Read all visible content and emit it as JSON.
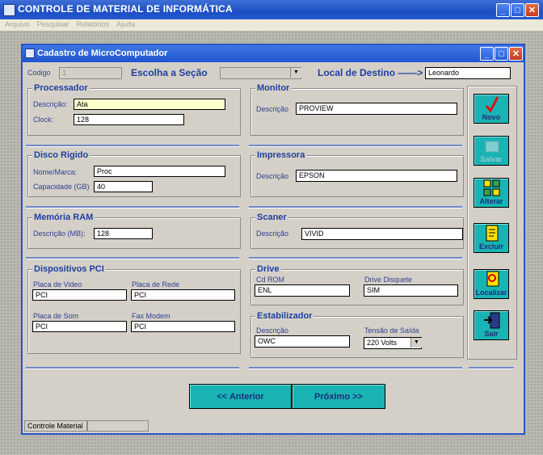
{
  "app": {
    "title": "CONTROLE DE MATERIAL DE INFORMÁTICA"
  },
  "menu": [
    "Arquivo",
    "Pesquisar",
    "Relatórios",
    "Ajuda"
  ],
  "form": {
    "title": "Cadastro de MicroComputador",
    "codigo_label": "Codigo",
    "codigo_value": "1",
    "secao_label": "Escolha a Seção",
    "secao_value": "",
    "destino_label": "Local de Destino ——>",
    "destino_value": "Leonardo"
  },
  "processador": {
    "title": "Processador",
    "desc_label": "Descrição:",
    "desc_value": "Ata",
    "clock_label": "Clock:",
    "clock_value": "128"
  },
  "disco": {
    "title": "Disco Rigido",
    "nome_label": "Nome/Marca:",
    "nome_value": "Proc",
    "cap_label": "Capacidade (GB)",
    "cap_value": "40"
  },
  "memoria": {
    "title": "Memória RAM",
    "desc_label": "Descrição (MB):",
    "desc_value": "128"
  },
  "pci": {
    "title": "Dispositivos PCI",
    "video_label": "Placa de Video",
    "video_value": "PCI",
    "rede_label": "Placa de Rede",
    "rede_value": "PCI",
    "som_label": "Placa de Som",
    "som_value": "PCI",
    "fax_label": "Fax Modem",
    "fax_value": "PCI"
  },
  "monitor": {
    "title": "Monitor",
    "desc_label": "Descrição",
    "desc_value": "PROVIEW"
  },
  "impressora": {
    "title": "Impressora",
    "desc_label": "Descrição",
    "desc_value": "EPSON"
  },
  "scaner": {
    "title": "Scaner",
    "desc_label": "Descrição",
    "desc_value": "VIVID"
  },
  "drive": {
    "title": "Drive",
    "cd_label": "Cd ROM",
    "cd_value": "ENL",
    "disq_label": "Drive Disquete",
    "disq_value": "SIM"
  },
  "estab": {
    "title": "Estabilizador",
    "desc_label": "Descrição",
    "desc_value": "OWC",
    "tensao_label": "Tensão de Saída",
    "tensao_value": "220 Volts"
  },
  "toolbar": {
    "novo": "Novo",
    "salvar": "Salvar",
    "alterar": "Alterar",
    "excluir": "Excluir",
    "localizar": "Localizar",
    "sair": "Sair"
  },
  "nav": {
    "anterior": "<<  Anterior",
    "proximo": "Próximo  >>"
  },
  "status": {
    "text": "Controle Material"
  },
  "colors": {
    "title_bar": "#1f55cf",
    "button": "#1ab3b3",
    "label": "#1f3fa0"
  }
}
